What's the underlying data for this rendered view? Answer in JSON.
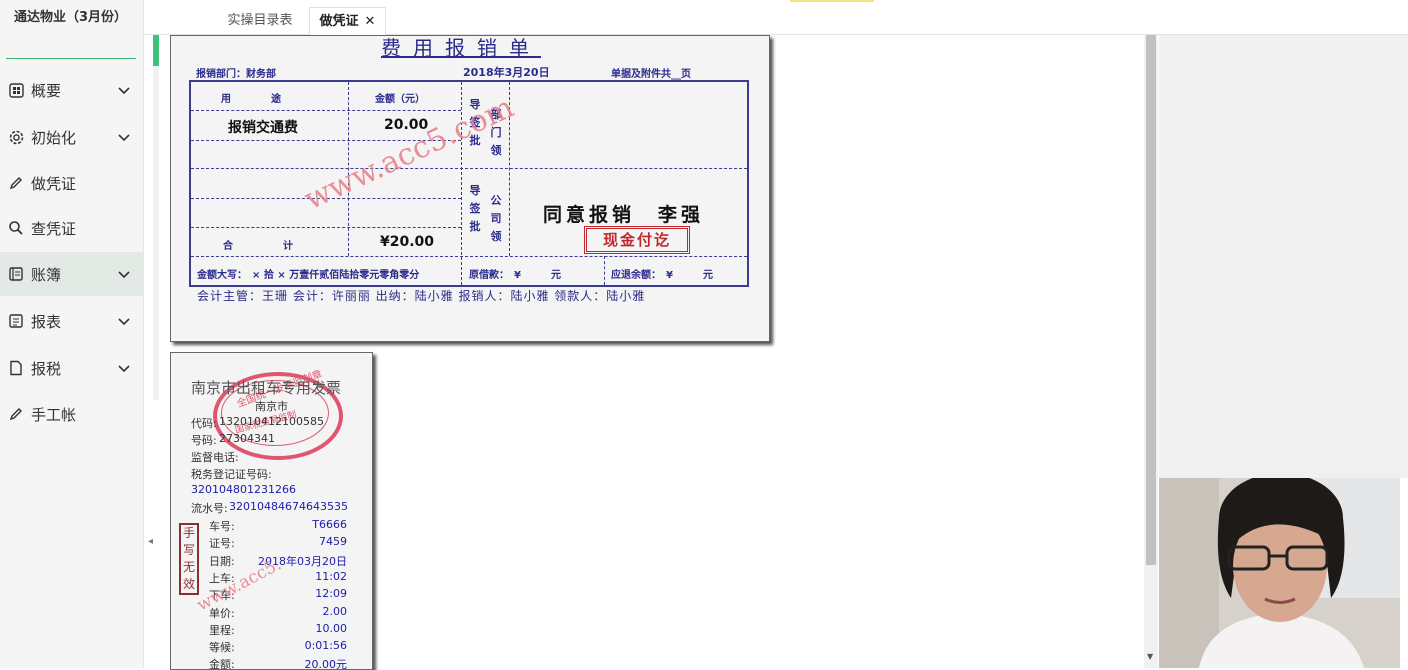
{
  "sidebar": {
    "company": "通达物业（3月份）",
    "items": [
      {
        "label": "概要",
        "icon": "grid-icon",
        "chevron": true
      },
      {
        "label": "初始化",
        "icon": "gear-icon",
        "chevron": true
      },
      {
        "label": "做凭证",
        "icon": "pen-icon",
        "chevron": false
      },
      {
        "label": "查凭证",
        "icon": "search-icon",
        "chevron": false
      },
      {
        "label": "账簿",
        "icon": "ledger-icon",
        "chevron": true,
        "active": true
      },
      {
        "label": "报表",
        "icon": "report-icon",
        "chevron": true
      },
      {
        "label": "报税",
        "icon": "document-icon",
        "chevron": true
      },
      {
        "label": "手工帐",
        "icon": "pen-icon",
        "chevron": false
      }
    ]
  },
  "tabs": [
    {
      "label": "实操目录表",
      "active": false
    },
    {
      "label": "做凭证",
      "active": true,
      "close": "✕"
    }
  ],
  "expense_form": {
    "title": "费用报销单",
    "dept": "报销部门：财务部",
    "date": "2018年3月20日",
    "attachments": "单据及附件共__页",
    "col_usage": "用　　　　途",
    "col_amount": "金额（元）",
    "row1_usage": "报销交通费",
    "row1_amount": "20.00",
    "sign_a": "导签批",
    "dept_label": "部门领",
    "sign_b": "导签批",
    "company_label": "公司领",
    "total_label": "合　　　　　计",
    "total_amount": "¥20.00",
    "amount_words": "金额大写：　× 拾 × 万壹仟贰佰陆拾零元零角零分",
    "advance": "原借款：　¥　　　元",
    "refund": "应退余额：　¥　　　元",
    "approval": "同意报销　李强",
    "paid_stamp": "现金付讫",
    "signers": "会计主管：王珊 会计：许丽丽 出纳：陆小雅 报销人：陆小雅 领款人：陆小雅",
    "watermark": "www.acc5.com"
  },
  "receipt": {
    "title": "南京市出租车专用发票",
    "seal_top": "全国统一发票监制章",
    "seal_city": "南京市",
    "seal_bottom": "国家税务局监制",
    "code_label": "代码:",
    "code_value": "132010412100585",
    "number_label": "号码:",
    "number_value": "27304341",
    "phone_label": "监督电话:",
    "tax_reg_label": "税务登记证号码:",
    "tax_reg_value": "320104801231266",
    "serial_label": "流水号:",
    "serial_value": "32010484674643535",
    "handwrite_note": "手写无效",
    "rows": [
      {
        "label": "车号:",
        "value": "T6666"
      },
      {
        "label": "证号:",
        "value": "7459"
      },
      {
        "label": "日期:",
        "value": "2018年03月20日"
      },
      {
        "label": "上车:",
        "value": "11:02"
      },
      {
        "label": "下车:",
        "value": "12:09"
      },
      {
        "label": "单价:",
        "value": "2.00"
      },
      {
        "label": "里程:",
        "value": "10.00"
      },
      {
        "label": "等候:",
        "value": "0:01:56"
      },
      {
        "label": "金额:",
        "value": "20.00元"
      }
    ],
    "watermark": "www.acc5."
  },
  "colors": {
    "accent": "#3cc27a",
    "form_ink": "#2b2b8c",
    "stamp": "#c0282e"
  }
}
